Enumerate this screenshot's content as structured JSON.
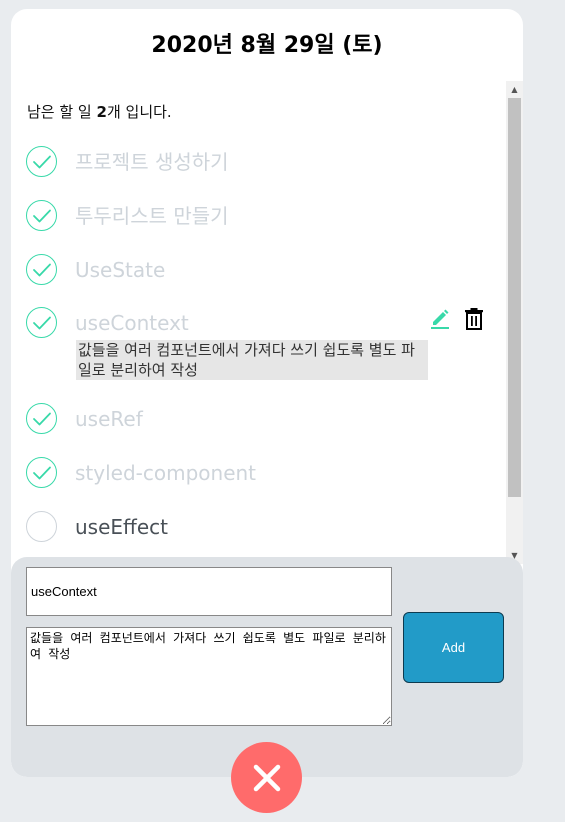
{
  "header": {
    "date": "2020년 8월 29일 (토)"
  },
  "summary": {
    "prefix": "남은 할 일 ",
    "count": "2",
    "suffix": "개 입니다."
  },
  "todos": [
    {
      "text": "프로젝트 생성하기",
      "done": true
    },
    {
      "text": "투두리스트 만들기",
      "done": true
    },
    {
      "text": "UseState",
      "done": true
    },
    {
      "text": "useContext",
      "done": true,
      "description": "값들을 여러 컴포넌트에서 가져다 쓰기 쉽도록 별도 파일로 분리하여 작성"
    },
    {
      "text": "useRef",
      "done": true
    },
    {
      "text": "styled-component",
      "done": true
    },
    {
      "text": "useEffect",
      "done": false
    }
  ],
  "form": {
    "title_value": "useContext",
    "description_value": "값들을 여러 컴포넌트에서 가져다 쓰기 쉽도록 별도 파일로 분리하여 작성",
    "add_label": "Add"
  },
  "icons": {
    "check": "check-icon",
    "edit": "pencil-icon",
    "delete": "trash-icon",
    "close": "close-icon"
  },
  "colors": {
    "accent_check": "#38d9a9",
    "done_text": "#ced4da",
    "active_text": "#495057",
    "add_button": "#229bc8",
    "close_button": "#ff6b6b"
  }
}
